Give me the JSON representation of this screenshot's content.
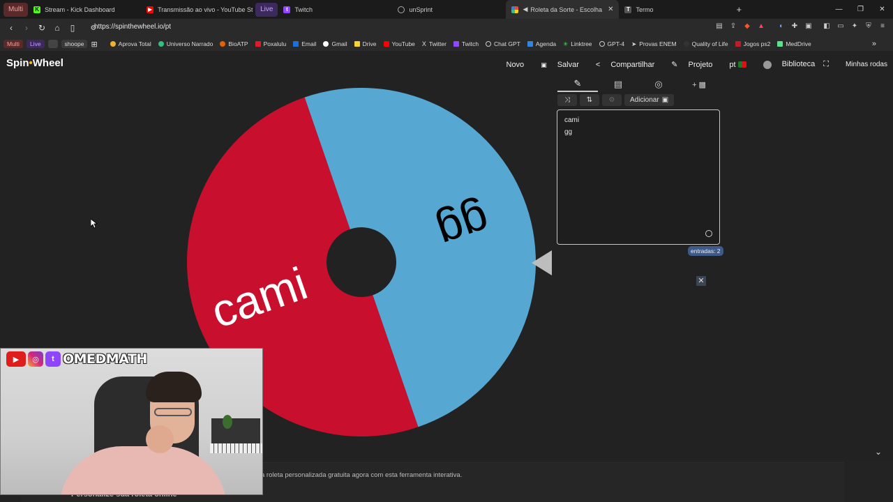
{
  "browser": {
    "tab_groups": [
      "Multi",
      "Live"
    ],
    "tabs": [
      {
        "label": "Stream - Kick Dashboard",
        "icon": "kick-icon",
        "color": "#53fc18"
      },
      {
        "label": "Transmissão ao vivo - YouTube Studio",
        "icon": "youtube-icon",
        "color": "#ff0000"
      },
      {
        "label": "Twitch",
        "icon": "twitch-icon",
        "color": "#9146ff"
      },
      {
        "label": "unSprint",
        "icon": "globe-icon",
        "color": "#aaaaaa"
      },
      {
        "label": "Roleta da Sorte - Escolha Pe...",
        "icon": "wheel-icon",
        "color": "#e24b4b",
        "active": true
      },
      {
        "label": "Termo",
        "icon": "termo-icon",
        "color": "#888888"
      }
    ],
    "url": "https://spinthewheel.io/pt",
    "bookmarks": [
      {
        "label": "Multi",
        "color": "#f0a0a0"
      },
      {
        "label": "Live",
        "color": "#c8a0ff"
      },
      {
        "label": "shoope",
        "color": "#dddddd"
      },
      {
        "label": "Aprova Total",
        "color": "#f2b12c"
      },
      {
        "label": "Universo Narrado",
        "color": "#2ec27e"
      },
      {
        "label": "BioATP",
        "color": "#e66100"
      },
      {
        "label": "Poxalulu",
        "color": "#e01b24"
      },
      {
        "label": "Email",
        "color": "#1c71d8"
      },
      {
        "label": "Gmail",
        "color": "#ffffff"
      },
      {
        "label": "Drive",
        "color": "#f6d32d"
      },
      {
        "label": "YouTube",
        "color": "#ff0000"
      },
      {
        "label": "Twitter",
        "color": "#ffffff"
      },
      {
        "label": "Twitch",
        "color": "#9146ff"
      },
      {
        "label": "Chat GPT",
        "color": "#cccccc"
      },
      {
        "label": "Agenda",
        "color": "#3584e4"
      },
      {
        "label": "Linktree",
        "color": "#43e660"
      },
      {
        "label": "GPT-4",
        "color": "#cccccc"
      },
      {
        "label": "Provas ENEM",
        "color": "#aaaaaa"
      },
      {
        "label": "Quality of Life",
        "color": "#333333"
      },
      {
        "label": "Jogos ps2",
        "color": "#c01c28"
      },
      {
        "label": "MedDrive",
        "color": "#57e389"
      }
    ]
  },
  "app": {
    "logo_part1": "Spin",
    "logo_o": "•",
    "logo_part2": "Wheel",
    "nav": {
      "novo": "Novo",
      "salvar": "Salvar",
      "compartilhar": "Compartilhar",
      "projeto": "Projeto",
      "lang": "pt",
      "biblioteca": "Biblioteca",
      "minhas_rodas": "Minhas rodas"
    }
  },
  "wheel": {
    "segments": [
      {
        "label": "gg",
        "color": "#56a8d2"
      },
      {
        "label": "cami",
        "color": "#c8102e"
      }
    ],
    "rotation_deg": -19,
    "hub_color": "#222222",
    "pointer_color": "#bdbdbd"
  },
  "panel": {
    "add_label": "Adicionar",
    "entries": [
      "cami",
      "gg"
    ],
    "count_label": "entradas: 2"
  },
  "bottom": {
    "text": "a roleta personalizada gratuita agora com esta ferramenta interativa.",
    "subtitle": "Personalize sua roleta online"
  },
  "webcam": {
    "handle": "OMEDMATH"
  }
}
